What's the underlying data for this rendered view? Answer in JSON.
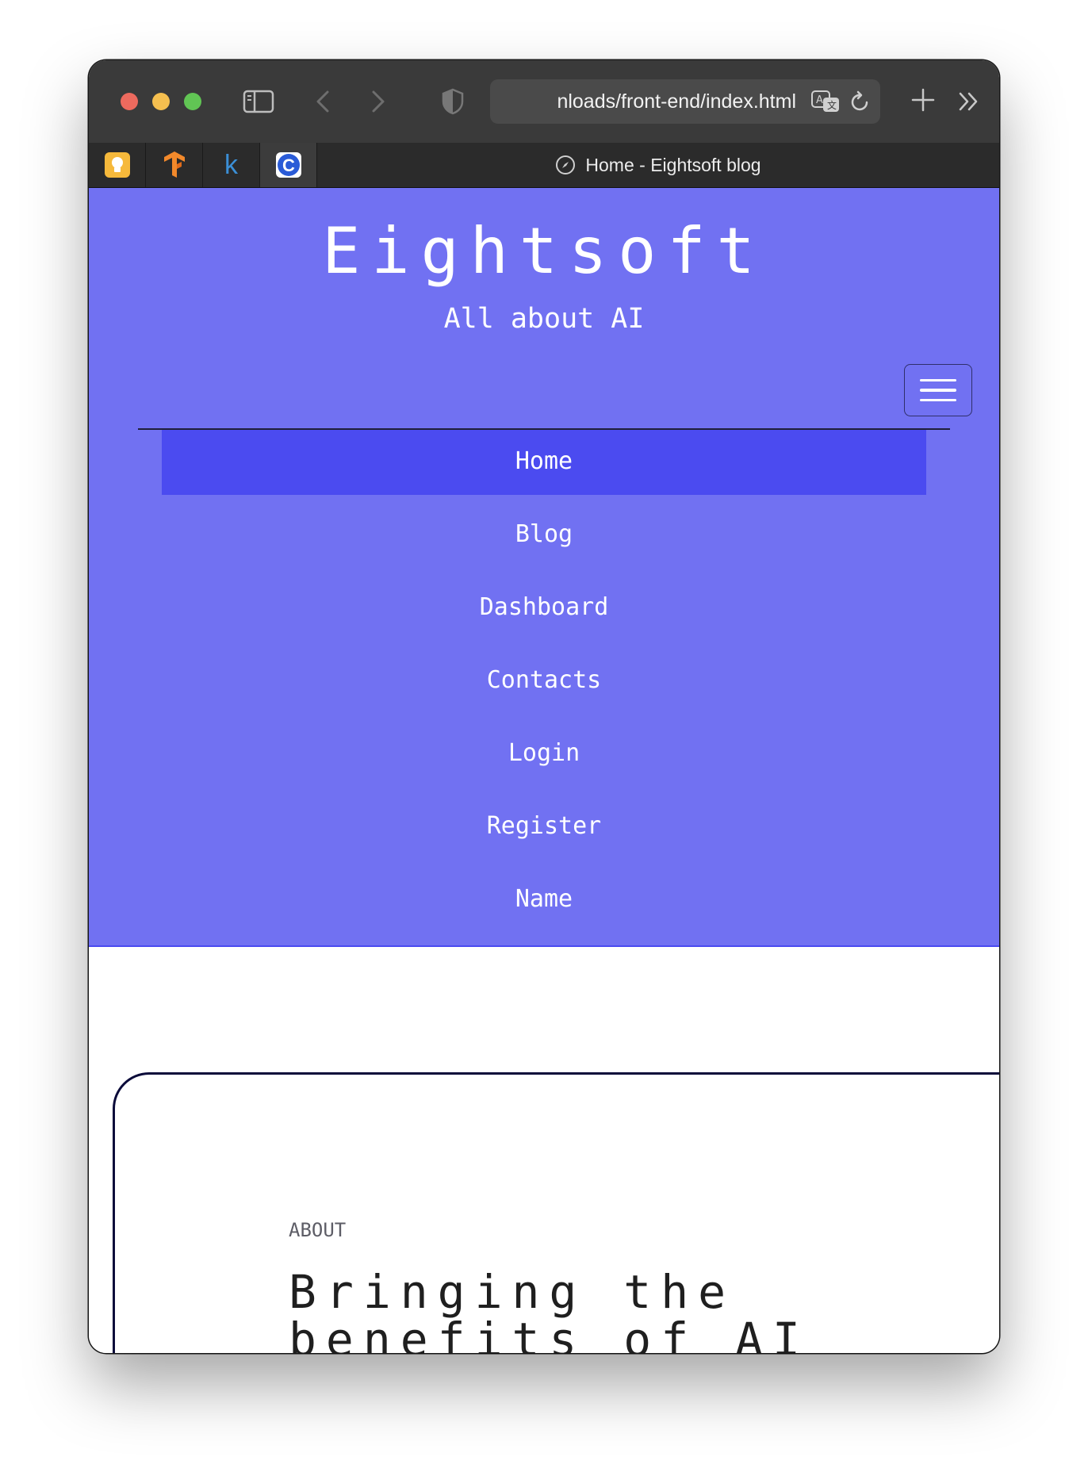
{
  "browser": {
    "url": "nloads/front-end/index.html",
    "tab_title": "Home - Eightsoft blog",
    "pinned_tabs": [
      {
        "icon": "lightbulb-icon",
        "color": "#f6b93b"
      },
      {
        "icon": "tensorflow-icon",
        "color": "#f2892b"
      },
      {
        "icon": "k-letter-icon",
        "label": "k",
        "color": "#3b8fd6"
      },
      {
        "icon": "c-letter-icon",
        "label": "C",
        "color": "#2a5bd7"
      }
    ]
  },
  "site": {
    "brand": "Eightsoft",
    "tagline": "All about AI",
    "colors": {
      "header_bg": "#7171f2",
      "active_nav_bg": "#4b4bf0"
    }
  },
  "nav": {
    "items": [
      "Home",
      "Blog",
      "Dashboard",
      "Contacts",
      "Login",
      "Register",
      "Name"
    ],
    "active": "Home"
  },
  "about": {
    "eyebrow": "ABOUT",
    "title": "Bringing the benefits of AI"
  }
}
